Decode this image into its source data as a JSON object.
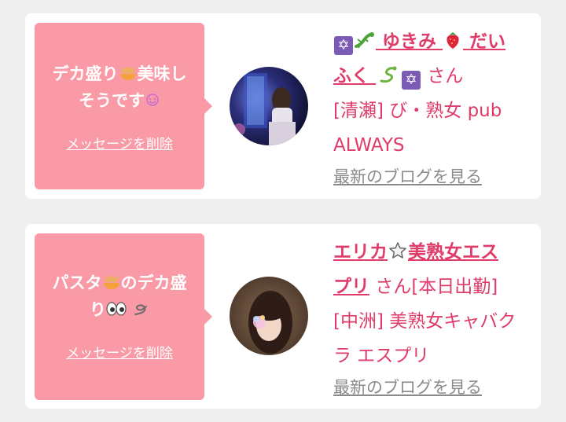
{
  "messages": [
    {
      "bubble_line1": "デカ盛り",
      "bubble_line1b": "美味し",
      "bubble_line2": "そうです",
      "delete_label": "メッセージを削除",
      "name_part1": "ゆきみ",
      "name_part2": "だい",
      "name_part3": "ふく",
      "san": "さん",
      "shop": "[清瀬] び・熟女 pub ALWAYS",
      "blog_label": "最新のブログを見る",
      "icons": [
        "star-of-david-icon",
        "lizard-icon",
        "strawberry-icon",
        "snake-icon"
      ]
    },
    {
      "bubble_line1a": "パスタ",
      "bubble_line1b": "のデカ盛",
      "bubble_line2": "り",
      "delete_label": "メッセージを削除",
      "name_part1": "エリカ",
      "name_part2": "美熟女エス",
      "name_part3": "プリ",
      "san_status": "さん[本日出勤]",
      "shop": "[中洲] 美熟女キャバクラ エスプリ",
      "blog_label": "最新のブログを見る",
      "icons": [
        "noodle-icon",
        "eyes-icon",
        "swirl-icon",
        "white-star-icon"
      ]
    }
  ],
  "colors": {
    "background": "#efefef",
    "bubble": "#f99aa6",
    "accent_text": "#e03c6a",
    "link_gray": "#8a8a8a"
  }
}
